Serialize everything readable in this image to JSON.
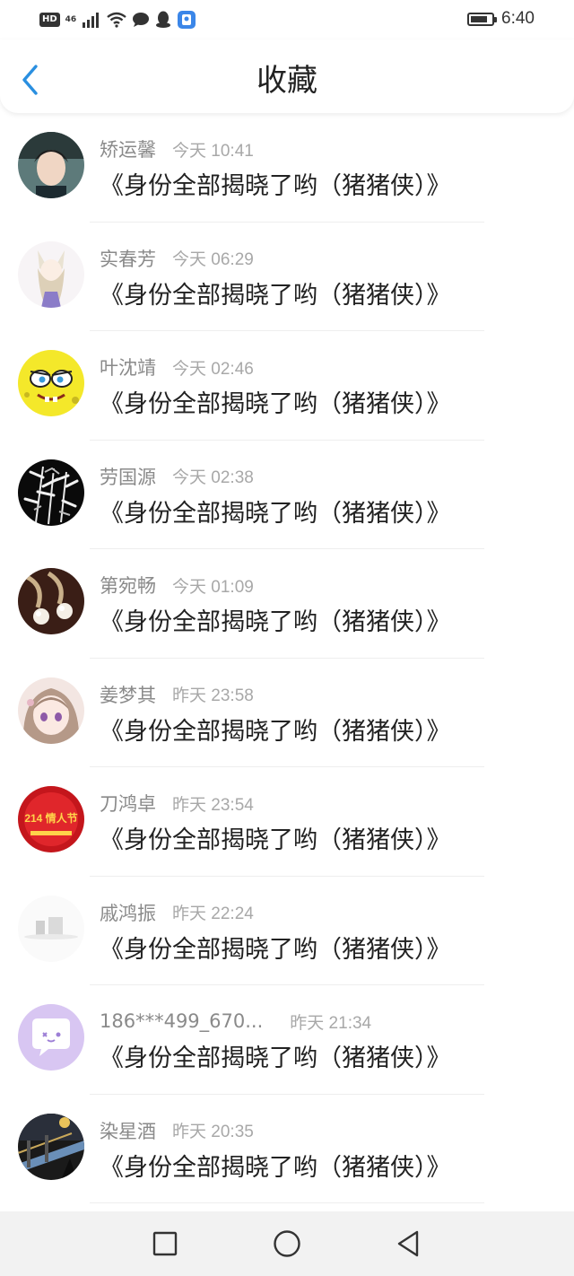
{
  "status_bar": {
    "hd": "HD",
    "network": "46",
    "time": "6:40",
    "battery_level": 0.8,
    "icons": [
      "signal-icon",
      "wifi-icon",
      "message-icon",
      "qq-icon",
      "app-icon"
    ]
  },
  "header": {
    "title": "收藏",
    "back_icon": "back-arrow-icon"
  },
  "items": [
    {
      "name": "矫运馨",
      "time": "今天 10:41",
      "message": "《身份全部揭晓了哟（猪猪侠）》"
    },
    {
      "name": "实春芳",
      "time": "今天 06:29",
      "message": "《身份全部揭晓了哟（猪猪侠）》"
    },
    {
      "name": "叶沈靖",
      "time": "今天 02:46",
      "message": "《身份全部揭晓了哟（猪猪侠）》"
    },
    {
      "name": "劳国源",
      "time": "今天 02:38",
      "message": "《身份全部揭晓了哟（猪猪侠）》"
    },
    {
      "name": "第宛畅",
      "time": "今天 01:09",
      "message": "《身份全部揭晓了哟（猪猪侠）》"
    },
    {
      "name": "姜梦其",
      "time": "昨天 23:58",
      "message": "《身份全部揭晓了哟（猪猪侠）》"
    },
    {
      "name": "刀鸿卓",
      "time": "昨天 23:54",
      "message": "《身份全部揭晓了哟（猪猪侠）》",
      "avatar_text": "214 情人节"
    },
    {
      "name": "戚鸿振",
      "time": "昨天 22:24",
      "message": "《身份全部揭晓了哟（猪猪侠）》"
    },
    {
      "name": "186***499_670...",
      "time": "昨天 21:34",
      "message": "《身份全部揭晓了哟（猪猪侠）》"
    },
    {
      "name": "染星酒",
      "time": "昨天 20:35",
      "message": "《身份全部揭晓了哟（猪猪侠）》"
    }
  ],
  "nav_bar": {
    "icons": [
      "recents-square-icon",
      "home-circle-icon",
      "back-triangle-icon"
    ]
  },
  "colors": {
    "accent": "#2a8fe0",
    "name_gray": "#8a8a8a",
    "time_gray": "#a8a8a8",
    "nav_bg": "#f2f2f2"
  }
}
